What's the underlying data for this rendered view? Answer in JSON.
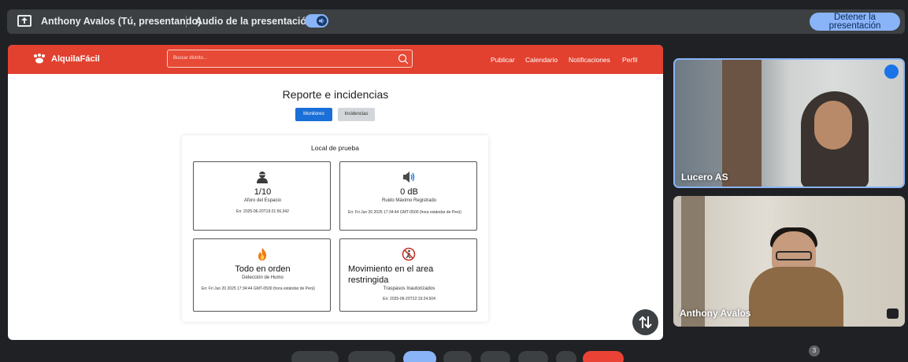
{
  "presenting_bar": {
    "presenter": "Anthony Avalos (Tú, presentando)",
    "audio_label": "Audio de la presentación",
    "stop_button": "Detener la presentación"
  },
  "app": {
    "brand": "AlquilaFácil",
    "search_placeholder": "Buscar distrito...",
    "nav": [
      "Publicar",
      "Calendario",
      "Notificaciones",
      "Perfil"
    ],
    "report_title": "Reporte e incidencias",
    "tabs": [
      "Monitoreo",
      "Incidencias"
    ],
    "card_title": "Local de prueba",
    "metrics": [
      {
        "icon": "person-icon",
        "value": "1/10",
        "label": "Aforo del Espacio",
        "timestamp": "En: 2025-06-20T19:21:56.342"
      },
      {
        "icon": "speaker-icon",
        "value": "0 dB",
        "label": "Ruido Máximo Registrado",
        "timestamp": "En: Fri Jun 20 2025 17:34:44 GMT-0500 (hora estándar de Perú)"
      },
      {
        "icon": "fire-icon",
        "value": "Todo en orden",
        "label": "Detección de Humo",
        "timestamp": "En: Fri Jun 20 2025 17:34:44 GMT-0500 (hora estándar de Perú)"
      },
      {
        "icon": "no-walking-icon",
        "value": "Movimiento en el area restringida",
        "label": "Traspasos Inautorizados",
        "timestamp": "En: 2025-06-20T22:19:24.604"
      }
    ]
  },
  "participants": [
    {
      "name": "Lucero AS",
      "speaking": true
    },
    {
      "name": "Anthony Avalos",
      "speaking": false
    }
  ],
  "bottom_badge": "3",
  "colors": {
    "header_red": "#e2412f",
    "accent_blue": "#8ab4f8",
    "tab_active": "#1a6fd8"
  }
}
